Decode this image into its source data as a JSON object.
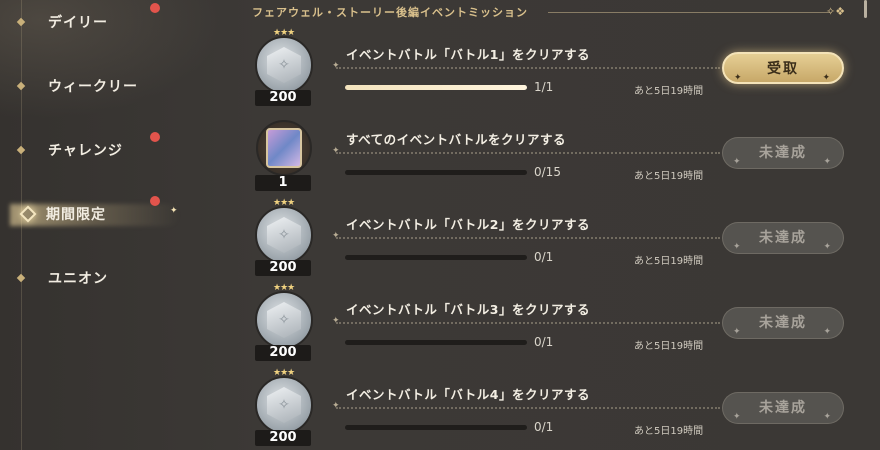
{
  "sidebar": {
    "tabs": [
      {
        "label": "デイリー",
        "badge": true,
        "active": false
      },
      {
        "label": "ウィークリー",
        "badge": false,
        "active": false
      },
      {
        "label": "チャレンジ",
        "badge": true,
        "active": false
      },
      {
        "label": "期間限定",
        "badge": true,
        "active": true
      },
      {
        "label": "ユニオン",
        "badge": false,
        "active": false
      }
    ]
  },
  "header": {
    "title": "フェアウェル・ストーリー後編イベントミッション"
  },
  "missions": [
    {
      "name": "イベントバトル「バトル1」をクリアする",
      "reward_icon": "silver-medal-icon",
      "reward_count": "200",
      "progress": "1/1",
      "progress_ratio": 1.0,
      "time_left": "あと5日19時間",
      "button": "受取",
      "button_state": "claim"
    },
    {
      "name": "すべてのイベントバトルをクリアする",
      "reward_icon": "character-card-icon",
      "reward_count": "1",
      "progress": "0/15",
      "progress_ratio": 0.0,
      "time_left": "あと5日19時間",
      "button": "未達成",
      "button_state": "disabled"
    },
    {
      "name": "イベントバトル「バトル2」をクリアする",
      "reward_icon": "silver-medal-icon",
      "reward_count": "200",
      "progress": "0/1",
      "progress_ratio": 0.0,
      "time_left": "あと5日19時間",
      "button": "未達成",
      "button_state": "disabled"
    },
    {
      "name": "イベントバトル「バトル3」をクリアする",
      "reward_icon": "silver-medal-icon",
      "reward_count": "200",
      "progress": "0/1",
      "progress_ratio": 0.0,
      "time_left": "あと5日19時間",
      "button": "未達成",
      "button_state": "disabled"
    },
    {
      "name": "イベントバトル「バトル4」をクリアする",
      "reward_icon": "silver-medal-icon",
      "reward_count": "200",
      "progress": "0/1",
      "progress_ratio": 0.0,
      "time_left": "あと5日19時間",
      "button": "未達成",
      "button_state": "disabled"
    }
  ],
  "colors": {
    "accent_gold": "#d9c08c",
    "badge_red": "#e2544c",
    "claim_button": "#e6cf95",
    "disabled_button": "#5f5c58"
  }
}
